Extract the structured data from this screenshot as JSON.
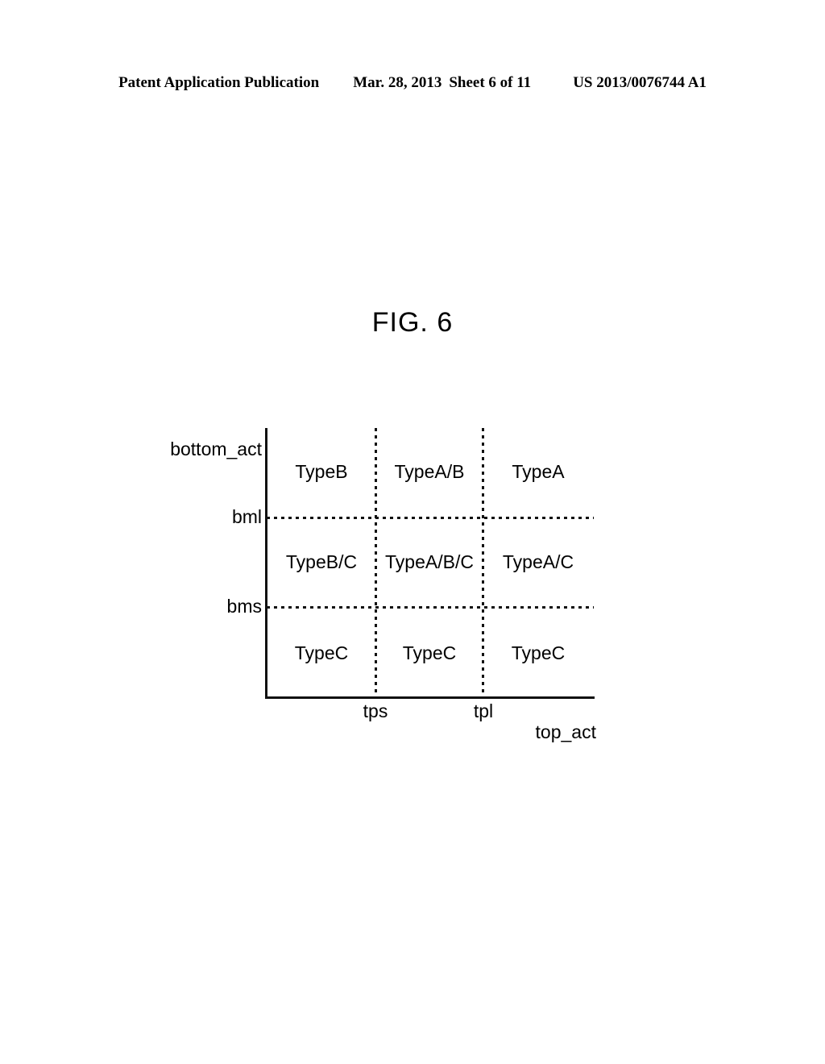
{
  "header": {
    "publication": "Patent Application Publication",
    "date": "Mar. 28, 2013",
    "sheet": "Sheet 6 of 11",
    "number": "US 2013/0076744 A1"
  },
  "figure": {
    "title": "FIG. 6"
  },
  "chart_data": {
    "type": "heatmap",
    "title": "FIG. 6",
    "xlabel": "top_act",
    "ylabel": "bottom_act",
    "grid": true,
    "legend": "none",
    "x_tick_labels": [
      "tps",
      "tpl"
    ],
    "y_tick_labels": [
      "bml",
      "bms"
    ],
    "x_bands": [
      "< tps",
      "tps - tpl",
      "> tpl"
    ],
    "y_bands": [
      "> bml",
      "bms - bml",
      "< bms"
    ],
    "cells": [
      [
        "TypeB",
        "TypeA/B",
        "TypeA"
      ],
      [
        "TypeB/C",
        "TypeA/B/C",
        "TypeA/C"
      ],
      [
        "TypeC",
        "TypeC",
        "TypeC"
      ]
    ],
    "rows": [
      {
        "band": "> bml",
        "values": [
          "TypeB",
          "TypeA/B",
          "TypeA"
        ]
      },
      {
        "band": "bms - bml",
        "values": [
          "TypeB/C",
          "TypeA/B/C",
          "TypeA/C"
        ]
      },
      {
        "band": "< bms",
        "values": [
          "TypeC",
          "TypeC",
          "TypeC"
        ]
      }
    ],
    "axis_color": "#111111",
    "gridline_style": "dotted"
  }
}
